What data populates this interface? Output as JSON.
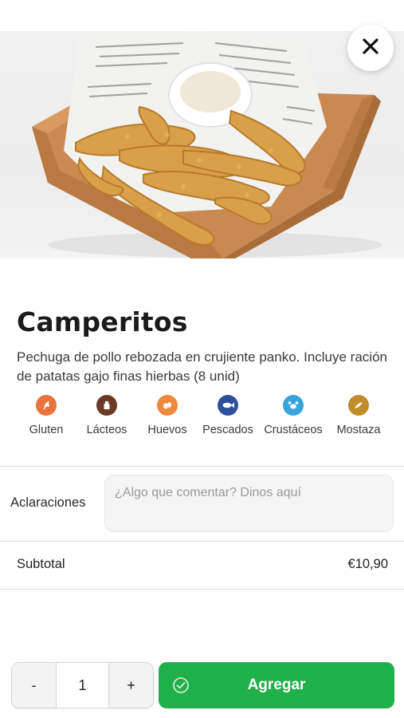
{
  "product": {
    "image_icon": "fried-chicken-photo",
    "close_icon": "close-icon",
    "name": "Camperitos",
    "description": "Pechuga de pollo rebozada en crujiente panko. Incluye ración de patatas gajo finas hierbas (8 unid)"
  },
  "allergens": [
    {
      "label": "Gluten",
      "icon": "wheat-icon",
      "color": "#e9733a"
    },
    {
      "label": "Lácteos",
      "icon": "milk-icon",
      "color": "#6b3a24"
    },
    {
      "label": "Huevos",
      "icon": "egg-icon",
      "color": "#ef8a3c"
    },
    {
      "label": "Pescados",
      "icon": "fish-icon",
      "color": "#2d4f9c"
    },
    {
      "label": "Crustáceos",
      "icon": "crab-icon",
      "color": "#3aa3dc"
    },
    {
      "label": "Mostaza",
      "icon": "mustard-icon",
      "color": "#c08d2c"
    }
  ],
  "notes": {
    "label": "Aclaraciones",
    "placeholder": "¿Algo que comentar? Dinos aquí",
    "value": ""
  },
  "subtotal": {
    "label": "Subtotal",
    "value": "€10,90"
  },
  "cart": {
    "decrement": "-",
    "quantity": "1",
    "increment": "+",
    "add_label": "Agregar",
    "accent": "#1fb04a"
  }
}
